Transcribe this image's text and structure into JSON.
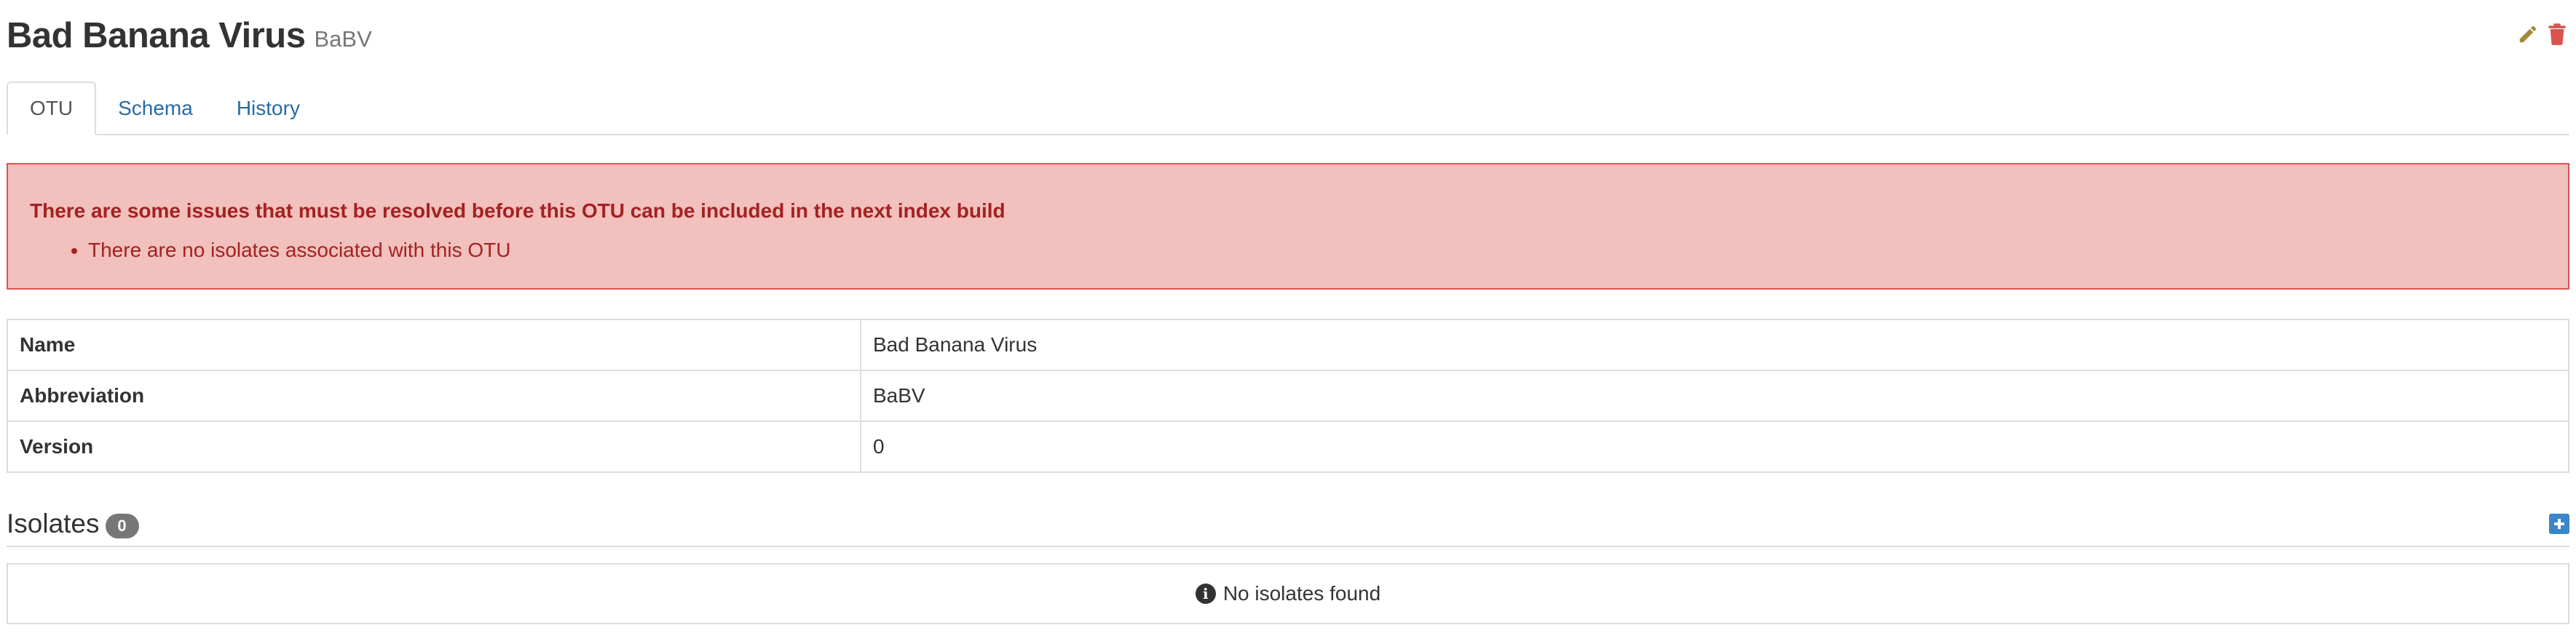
{
  "otu": {
    "name": "Bad Banana Virus",
    "abbreviation": "BaBV"
  },
  "header": {
    "edit_icon": "pencil-icon",
    "delete_icon": "trash-icon",
    "edit_color": "#a08a3b",
    "delete_color": "#d9534f"
  },
  "tabs": [
    {
      "label": "OTU",
      "active": true
    },
    {
      "label": "Schema",
      "active": false
    },
    {
      "label": "History",
      "active": false
    }
  ],
  "alert": {
    "title": "There are some issues that must be resolved before this OTU can be included in the next index build",
    "items": [
      "There are no isolates associated with this OTU"
    ],
    "bg_color": "#f2c0bd",
    "border_color": "#d9534f",
    "text_color": "#a32222"
  },
  "info_table": {
    "rows": [
      {
        "key": "Name",
        "value": "Bad Banana Virus"
      },
      {
        "key": "Abbreviation",
        "value": "BaBV"
      },
      {
        "key": "Version",
        "value": "0"
      }
    ]
  },
  "isolates": {
    "title": "Isolates",
    "count": "0",
    "add_icon": "plus-square-icon",
    "empty_icon": "info-circle-icon",
    "empty_message": "No isolates found"
  },
  "colors": {
    "link": "#2a6aa6",
    "accent": "#3a86c8"
  }
}
